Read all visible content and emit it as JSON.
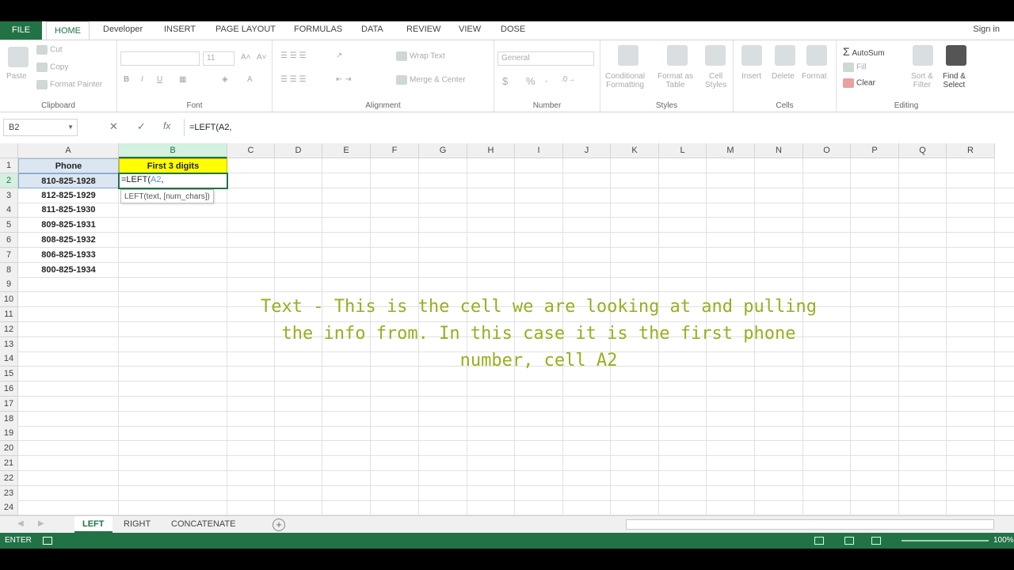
{
  "ribbon_tabs": [
    "FILE",
    "HOME",
    "Developer",
    "INSERT",
    "PAGE LAYOUT",
    "FORMULAS",
    "DATA",
    "REVIEW",
    "VIEW",
    "DOSE"
  ],
  "sign_in": "Sign in",
  "clipboard": {
    "paste": "Paste",
    "cut": "Cut",
    "copy": "Copy",
    "format_painter": "Format Painter",
    "label": "Clipboard"
  },
  "font": {
    "size": "11",
    "bold": "B",
    "italic": "I",
    "underline": "U",
    "label": "Font"
  },
  "alignment": {
    "wrap_text": "Wrap Text",
    "merge_center": "Merge & Center",
    "label": "Alignment"
  },
  "number": {
    "format": "General",
    "currency": "$",
    "percent": "%",
    "label": "Number"
  },
  "styles": {
    "conditional": "Conditional",
    "formatting": "Formatting",
    "format_as": "Format as",
    "table": "Table",
    "cell": "Cell",
    "cell_styles": "Styles",
    "label": "Styles"
  },
  "cells": {
    "insert": "Insert",
    "delete": "Delete",
    "format": "Format",
    "label": "Cells"
  },
  "editing": {
    "autosum": "AutoSum",
    "fill": "Fill",
    "clear": "Clear",
    "sort_filter": "Sort &",
    "filter": "Filter",
    "find_select": "Find &",
    "select": "Select",
    "label": "Editing"
  },
  "formula_bar": {
    "name_box": "B2",
    "cancel": "✕",
    "enter": "✓",
    "fx": "fx",
    "formula": "=LEFT(A2,"
  },
  "columns": [
    "A",
    "B",
    "C",
    "D",
    "E",
    "F",
    "G",
    "H",
    "I",
    "J",
    "K",
    "L",
    "M",
    "N",
    "O",
    "P",
    "Q",
    "R"
  ],
  "rows": [
    "1",
    "2",
    "3",
    "4",
    "5",
    "6",
    "7",
    "8",
    "9",
    "10",
    "11",
    "12",
    "13",
    "14",
    "15",
    "16",
    "17",
    "18",
    "19",
    "20",
    "21",
    "22",
    "23",
    "24"
  ],
  "sheet": {
    "header_a": "Phone",
    "header_b": "First 3 digits",
    "phones": [
      "810-825-1928",
      "812-825-1929",
      "811-825-1930",
      "809-825-1931",
      "808-825-1932",
      "806-825-1933",
      "800-825-1934"
    ],
    "active_prefix": "=LEFT(",
    "active_ref": "A2",
    "active_suffix": ",",
    "tooltip": "LEFT(text, [num_chars])"
  },
  "annotation": {
    "line1": "Text - This is the cell we are looking at and pulling",
    "line2": "the info from.  In this case it is the first phone",
    "line3": "number, cell A2"
  },
  "sheet_tabs": [
    "LEFT",
    "RIGHT",
    "CONCATENATE"
  ],
  "status": {
    "mode": "ENTER",
    "zoom": "100%"
  }
}
